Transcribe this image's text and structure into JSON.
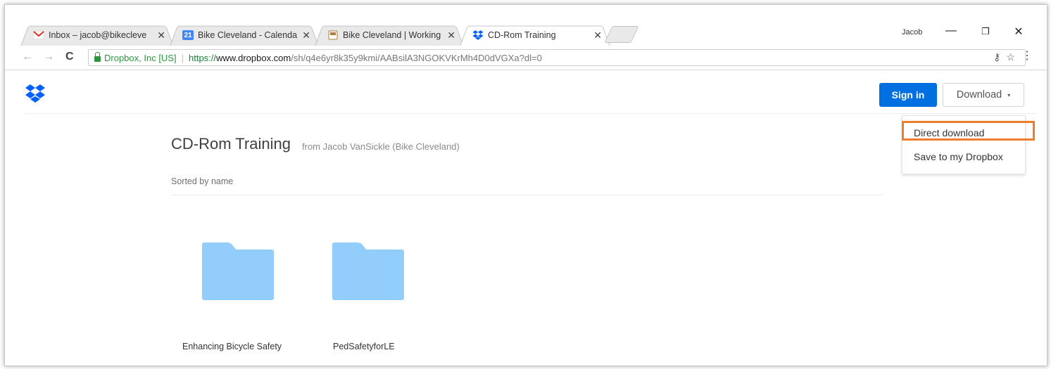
{
  "browser": {
    "tabs": [
      {
        "title": "Inbox – jacob@bikecleve",
        "icon": "gmail-icon",
        "active": false
      },
      {
        "title": "Bike Cleveland - Calenda",
        "icon": "calendar-icon",
        "calendar_day": "21",
        "active": false
      },
      {
        "title": "Bike Cleveland | Working",
        "icon": "drive-doc-icon",
        "active": false
      },
      {
        "title": "CD-Rom Training",
        "icon": "dropbox-icon",
        "active": true
      }
    ],
    "tab_close": "✕",
    "profile_name": "Jacob",
    "window_controls": {
      "minimize": "—",
      "restore": "❐",
      "close": "✕"
    },
    "nav": {
      "back": "←",
      "forward": "→",
      "reload": "C"
    },
    "address": {
      "secure_label": "Dropbox, Inc [US]",
      "url_scheme": "https://",
      "url_host_prefix": "www.",
      "url_host": "dropbox.com",
      "url_path": "/sh/q4e6yr8k35y9kmi/AABsilA3NGOKVKrMh4D0dVGXa?dl=0"
    },
    "omnibox_icons": [
      "key-icon",
      "star-icon"
    ],
    "key_glyph": "⚷",
    "star_glyph": "☆",
    "menu_glyph": "⋮"
  },
  "page": {
    "signin_label": "Sign in",
    "download_label": "Download",
    "download_caret": "▾",
    "download_menu": [
      "Direct download",
      "Save to my Dropbox"
    ],
    "highlighted_item": "Direct download",
    "highlight_color": "#ef7d2c",
    "folder_title": "CD-Rom Training",
    "folder_from": "from Jacob VanSickle (Bike Cleveland)",
    "sorted_label": "Sorted by name",
    "folders": [
      "Enhancing Bicycle Safety",
      "PedSafetyforLE"
    ]
  },
  "colors": {
    "accent": "#0070e0",
    "folder": "#92cdfb",
    "secure": "#2e9440"
  }
}
